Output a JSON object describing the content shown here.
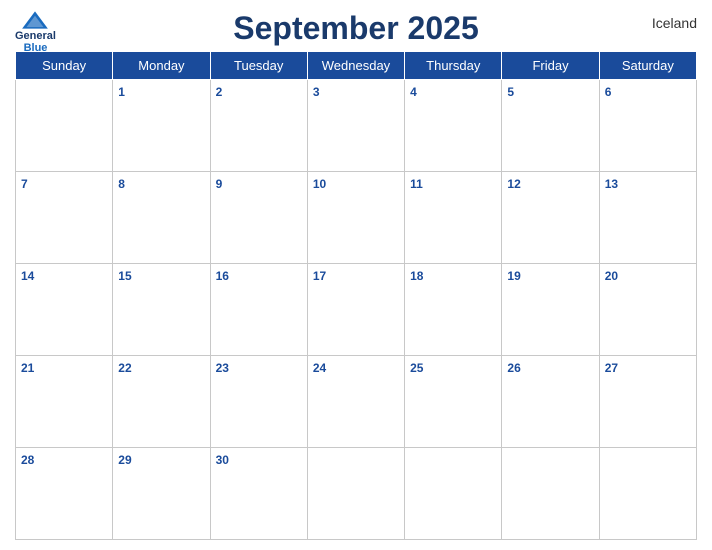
{
  "header": {
    "title": "September 2025",
    "country": "Iceland",
    "logo": {
      "general": "General",
      "blue": "Blue"
    }
  },
  "weekdays": [
    "Sunday",
    "Monday",
    "Tuesday",
    "Wednesday",
    "Thursday",
    "Friday",
    "Saturday"
  ],
  "weeks": [
    [
      null,
      1,
      2,
      3,
      4,
      5,
      6
    ],
    [
      7,
      8,
      9,
      10,
      11,
      12,
      13
    ],
    [
      14,
      15,
      16,
      17,
      18,
      19,
      20
    ],
    [
      21,
      22,
      23,
      24,
      25,
      26,
      27
    ],
    [
      28,
      29,
      30,
      null,
      null,
      null,
      null
    ]
  ],
  "colors": {
    "header_bg": "#1a4b9b",
    "title": "#1a3a6b",
    "day_num": "#1a4b9b"
  }
}
